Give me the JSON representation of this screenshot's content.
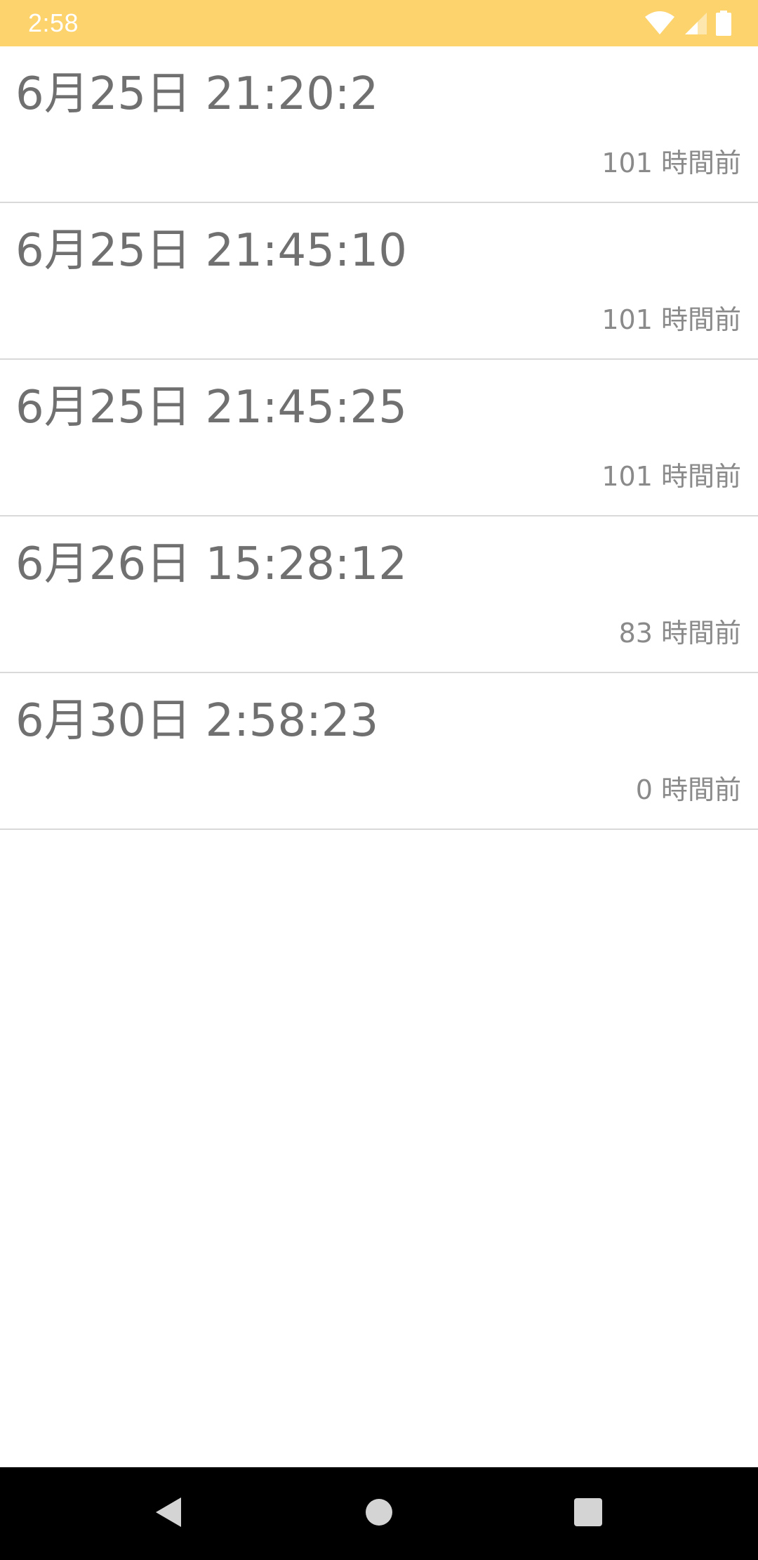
{
  "status_bar": {
    "time": "2:58",
    "background_color": "#FDD36E",
    "icons": [
      "wifi-icon",
      "cell-signal-icon",
      "battery-icon"
    ]
  },
  "history": {
    "items": [
      {
        "timestamp": "6月25日 21:20:2",
        "elapsed": "101 時間前"
      },
      {
        "timestamp": "6月25日 21:45:10",
        "elapsed": "101 時間前"
      },
      {
        "timestamp": "6月25日 21:45:25",
        "elapsed": "101 時間前"
      },
      {
        "timestamp": "6月26日 15:28:12",
        "elapsed": "83 時間前"
      },
      {
        "timestamp": "6月30日 2:58:23",
        "elapsed": "0 時間前"
      }
    ]
  },
  "navigation": {
    "buttons": [
      "back-icon",
      "home-icon",
      "recents-icon"
    ]
  }
}
